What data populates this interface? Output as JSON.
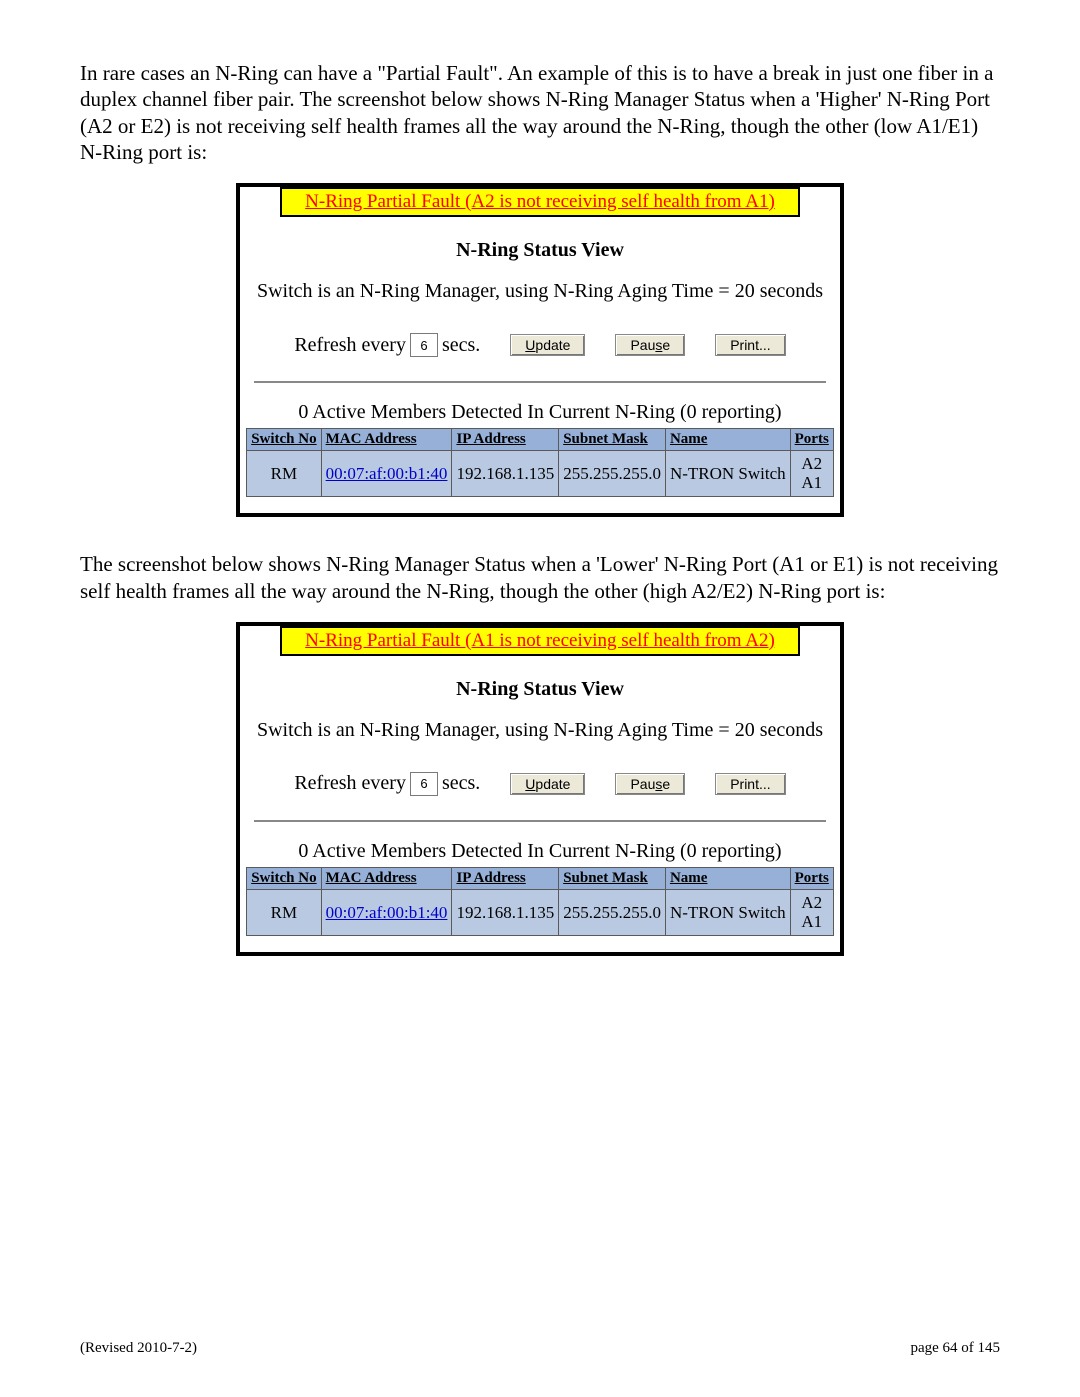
{
  "para1": "In rare cases an N-Ring can have a \"Partial Fault\".  An example of this is to have a break in just one fiber in a duplex channel fiber pair.  The screenshot below shows N-Ring Manager Status when a 'Higher' N-Ring Port (A2 or E2) is not receiving self health frames all the way around the N-Ring, though the other (low A1/E1) N-Ring port is:",
  "para2": "The screenshot below shows N-Ring Manager Status when a 'Lower' N-Ring Port (A1 or E1) is not receiving self health frames all the way around the N-Ring, though the other (high A2/E2) N-Ring port is:",
  "panel1": {
    "fault": "N-Ring Partial Fault (A2 is not receiving self health from A1)",
    "title": "N-Ring Status View",
    "aging": "Switch is an N-Ring Manager, using N-Ring Aging Time = 20 seconds",
    "refresh_prefix": "Refresh every",
    "refresh_value": "6",
    "refresh_suffix": "secs.",
    "btn_update_pre": "",
    "btn_update_u": "U",
    "btn_update_post": "pdate",
    "btn_pause_pre": "Pau",
    "btn_pause_u": "s",
    "btn_pause_post": "e",
    "btn_print": "Print...",
    "members": "0 Active Members Detected In Current N-Ring (0 reporting)",
    "headers": {
      "c1": "Switch No",
      "c2": "MAC Address",
      "c3": "IP Address",
      "c4": "Subnet Mask",
      "c5": "Name",
      "c6": "Ports"
    },
    "row": {
      "switchno": "RM",
      "mac": "00:07:af:00:b1:40",
      "ip": "192.168.1.135",
      "mask": "255.255.255.0",
      "name": "N-TRON Switch",
      "port1": "A2",
      "port2": "A1"
    }
  },
  "panel2": {
    "fault": "N-Ring Partial Fault (A1 is not receiving self health from A2)",
    "title": "N-Ring Status View",
    "aging": "Switch is an N-Ring Manager, using N-Ring Aging Time = 20 seconds",
    "refresh_prefix": "Refresh every",
    "refresh_value": "6",
    "refresh_suffix": "secs.",
    "btn_update_pre": "",
    "btn_update_u": "U",
    "btn_update_post": "pdate",
    "btn_pause_pre": "Pau",
    "btn_pause_u": "s",
    "btn_pause_post": "e",
    "btn_print": "Print...",
    "members": "0 Active Members Detected In Current N-Ring (0 reporting)",
    "headers": {
      "c1": "Switch No",
      "c2": "MAC Address",
      "c3": "IP Address",
      "c4": "Subnet Mask",
      "c5": "Name",
      "c6": "Ports"
    },
    "row": {
      "switchno": "RM",
      "mac": "00:07:af:00:b1:40",
      "ip": "192.168.1.135",
      "mask": "255.255.255.0",
      "name": "N-TRON Switch",
      "port1": "A2",
      "port2": "A1"
    }
  },
  "footer_left": "(Revised 2010-7-2)",
  "footer_right": "page 64 of 145"
}
